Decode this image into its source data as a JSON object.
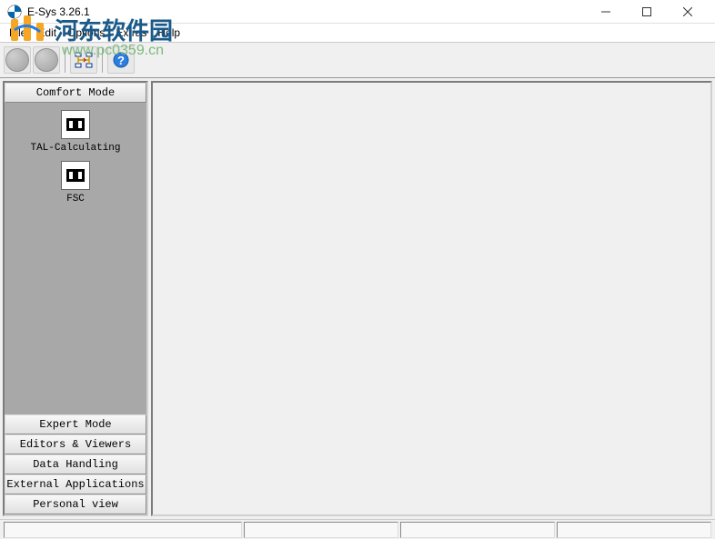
{
  "window": {
    "title": "E-Sys 3.26.1"
  },
  "menu": {
    "file": "File",
    "edit": "Edit",
    "options": "Options",
    "extras": "Extras",
    "help": "Help"
  },
  "sidebar": {
    "comfort_mode": "Comfort Mode",
    "items": [
      {
        "label": "TAL-Calculating"
      },
      {
        "label": "FSC"
      }
    ],
    "buttons": {
      "expert": "Expert Mode",
      "editors": "Editors & Viewers",
      "data": "Data Handling",
      "external": "External Applications",
      "personal": "Personal view"
    }
  },
  "watermark": {
    "text": "河东软件园",
    "url": "www.pc0359.cn"
  }
}
